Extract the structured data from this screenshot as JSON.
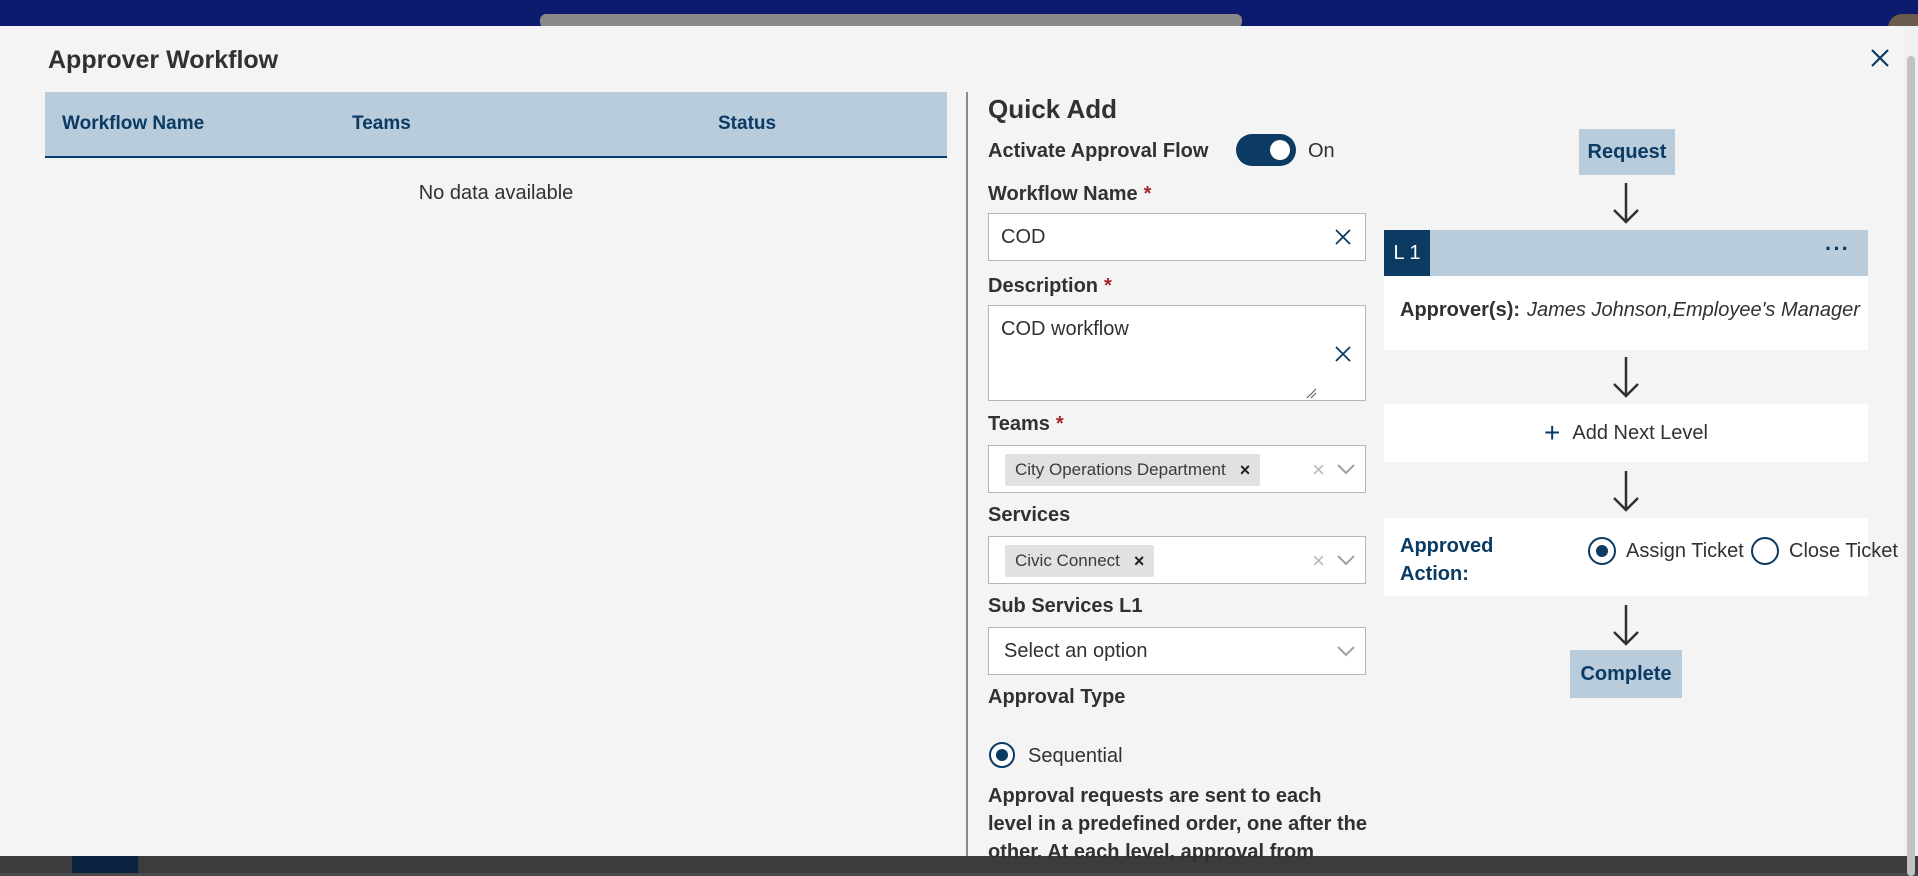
{
  "modal": {
    "title": "Approver Workflow"
  },
  "table": {
    "columns": [
      "Workflow Name",
      "Teams",
      "Status"
    ],
    "empty_text": "No data available"
  },
  "quick_add": {
    "title": "Quick Add",
    "activate_label": "Activate Approval Flow",
    "activate_state": "On",
    "workflow_name_label": "Workflow Name",
    "workflow_name_value": "COD",
    "description_label": "Description",
    "description_value": "COD workflow",
    "teams_label": "Teams",
    "teams_selected": [
      "City Operations Department"
    ],
    "services_label": "Services",
    "services_selected": [
      "Civic Connect"
    ],
    "sub_services_label": "Sub Services L1",
    "sub_services_placeholder": "Select an option",
    "approval_type_label": "Approval Type",
    "approval_type_option": "Sequential",
    "approval_type_description": "Approval requests are sent to each level in a predefined order, one after the other. At each level, approval from"
  },
  "flow": {
    "request_label": "Request",
    "level_tag": "L 1",
    "more_label": "···",
    "approvers_label": "Approver(s):",
    "approvers_value": "James Johnson,Employee's Manager",
    "add_level_label": "Add Next Level",
    "approved_action_label": "Approved Action:",
    "approved_action_line1": "Approved",
    "approved_action_line2": "Action:",
    "options": [
      "Assign Ticket",
      "Close Ticket"
    ],
    "selected_option": "Assign Ticket",
    "complete_label": "Complete"
  },
  "colors": {
    "primary": "#0b3a63",
    "header_bg": "#b8ccdc",
    "required": "#a4262c"
  }
}
